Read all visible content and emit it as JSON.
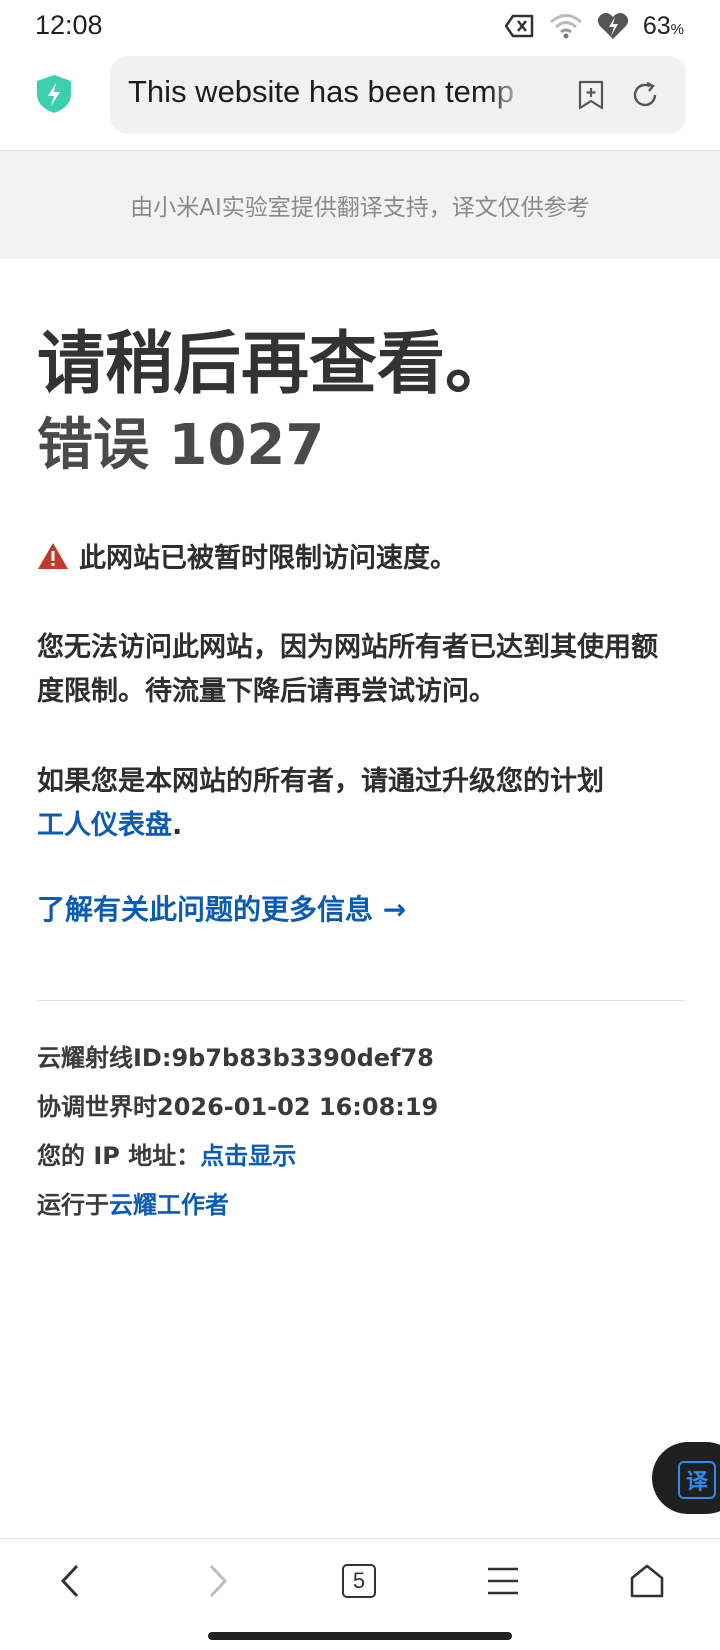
{
  "status_bar": {
    "time": "12:08",
    "battery_percent": "63",
    "battery_unit": "%"
  },
  "browser": {
    "url_text": "This website has been temp",
    "tab_count": "5"
  },
  "translate_banner": "由小米AI实验室提供翻译支持，译文仅供参考",
  "page": {
    "title": "请稍后再查看。",
    "error_code": "错误 1027",
    "warning": "此网站已被暂时限制访问速度。",
    "paragraph1": "您无法访问此网站，因为网站所有者已达到其使用额度限制。待流量下降后请再尝试访问。",
    "paragraph2_text": "如果您是本网站的所有者，请通过升级您的计划",
    "paragraph2_link": "工人仪表盘",
    "paragraph2_end": ".",
    "more_info_link": "了解有关此问题的更多信息 →",
    "ray_id": "云耀射线ID:9b7b83b3390def78",
    "utc_time": "协调世界时2026-01-02 16:08:19",
    "ip_label": "您的 IP 地址：",
    "ip_link": "点击显示",
    "runs_on_label": "运行于",
    "runs_on_link": "云耀工作者"
  },
  "fab": {
    "label": "译"
  },
  "colors": {
    "link": "#0b5bb5",
    "warning": "#c0392b",
    "shield": "#3ecfb0"
  }
}
